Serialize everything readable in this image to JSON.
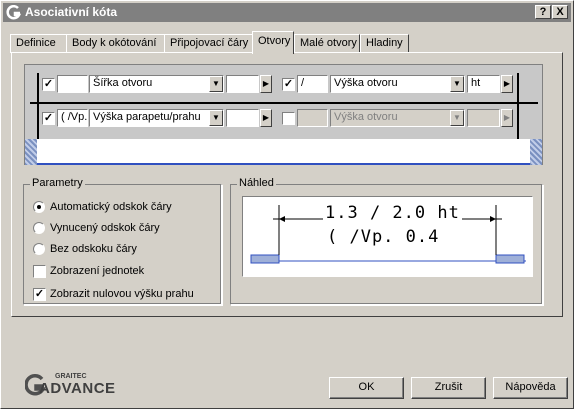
{
  "window": {
    "title": "Asociativní kóta",
    "help_button": "?",
    "close_button": "X"
  },
  "tabs": [
    {
      "label": "Definice",
      "active": false
    },
    {
      "label": "Body k okótování",
      "active": false
    },
    {
      "label": "Připojovací čáry",
      "active": false
    },
    {
      "label": "Otvory",
      "active": true
    },
    {
      "label": "Malé otvory",
      "active": false
    },
    {
      "label": "Hladiny",
      "active": false
    }
  ],
  "openings": {
    "row1": {
      "left_checked": true,
      "left_prefix": "",
      "left_combo": "Šířka otvoru",
      "left_suffix": "",
      "right_checked": true,
      "right_prefix": "/",
      "right_combo": "Výška otvoru",
      "right_suffix": "ht"
    },
    "row2": {
      "left_checked": true,
      "left_prefix": "( /Vp.",
      "left_combo": "Výška parapetu/prahu",
      "left_suffix": "",
      "right_checked": false,
      "right_prefix": "",
      "right_combo": "Výška otvoru",
      "right_suffix": ""
    },
    "arrow_glyph": "▶",
    "dropdown_glyph": "▼"
  },
  "parameters": {
    "title": "Parametry",
    "options": [
      {
        "label": "Automatický odskok čáry",
        "selected": true
      },
      {
        "label": "Vynucený odskok čáry",
        "selected": false
      },
      {
        "label": "Bez odskoku čáry",
        "selected": false
      }
    ],
    "checkboxes": [
      {
        "label": "Zobrazení jednotek",
        "checked": false
      },
      {
        "label": "Zobrazit nulovou výšku prahu",
        "checked": true
      }
    ]
  },
  "preview": {
    "title": "Náhled",
    "line1": "1.3 / 2.0 ht",
    "line2": "( /Vp. 0.4"
  },
  "logo": {
    "brand_small": "GRAITEC",
    "brand_large": "ADVANCE"
  },
  "buttons": {
    "ok": "OK",
    "close": "Zrušit",
    "help": "Nápověda"
  },
  "colors": {
    "titlebar": "#808080",
    "face": "#d4d0c8",
    "hatch": "#7a90c0"
  }
}
